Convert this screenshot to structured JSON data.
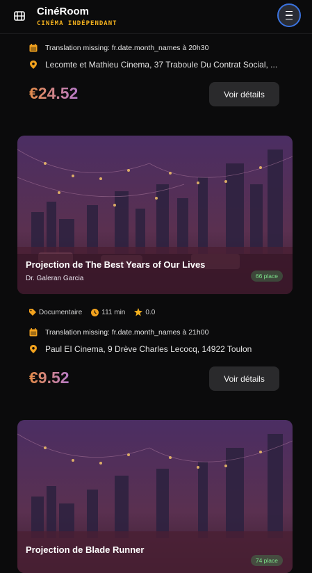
{
  "header": {
    "title": "CinéRoom",
    "subtitle": "CINÉMA INDÉPENDANT",
    "menu_icon": "hamburger-icon"
  },
  "colors": {
    "accent": "#f2b01e",
    "background": "#0b0b0c",
    "menu_ring": "#3a73e0",
    "seat_badge": "#7de08a"
  },
  "events": [
    {
      "date_text": "Translation missing: fr.date.month_names à 20h30",
      "location": "Lecomte et Mathieu Cinema, 37 Traboule Du Contrat Social, ...",
      "price": "€24.52",
      "details_label": "Voir détails"
    },
    {
      "title": "Projection de The Best Years of Our Lives",
      "director": "Dr. Galeran Garcia",
      "seats": "66 place",
      "genre": "Documentaire",
      "duration": "111 min",
      "rating": "0.0",
      "date_text": "Translation missing: fr.date.month_names à 21h00",
      "location": "Paul EI Cinema, 9 Drève Charles Lecocq, 14922 Toulon",
      "price": "€9.52",
      "details_label": "Voir détails"
    },
    {
      "title": "Projection de Blade Runner",
      "seats": "74 place"
    }
  ]
}
